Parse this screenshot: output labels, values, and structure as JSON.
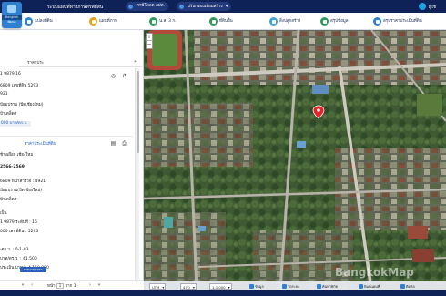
{
  "topbar": {
    "app_title": "ระบบแผนที่ทางภาษีทรัพย์สิน",
    "buttons": [
      {
        "label": "ภาษีโหลด อปท.",
        "icon": "download-icon"
      },
      {
        "label": "ปรับกรอบเลี่ยมสร้าง",
        "icon": "layers-icon"
      }
    ],
    "user_name": "ผู้ใช้"
  },
  "app_badge": {
    "line1": "Bangkok",
    "line2": "พัฒนา"
  },
  "layer_toolbar": {
    "items": [
      {
        "label": "แปลงที่ดิน",
        "icon": "parcel-icon",
        "color": "#2f80d0"
      },
      {
        "label": "แผนที่ภาพ",
        "icon": "map-icon",
        "color": "#e6a21c"
      },
      {
        "label": "น.ส. 3 ก.",
        "icon": "document-icon",
        "color": "#2f9a5a"
      },
      {
        "label": "ที่ดินอื่น",
        "icon": "land-icon",
        "color": "#2f9a5a"
      },
      {
        "label": "สิ่งปลูกสร้าง",
        "icon": "building-icon",
        "color": "#3fa5d8"
      },
      {
        "label": "สรุปข้อมูล",
        "icon": "chart-icon",
        "color": "#2f9a5a"
      },
      {
        "label": "สรุปราคาประเมินที่ดิน",
        "icon": "price-icon",
        "color": "#2f80d0"
      }
    ]
  },
  "panel": {
    "search_label": "ราคาประ",
    "card1": {
      "lines": [
        "1 9879 16",
        "6809 เลขที่ดิน 5293",
        "921",
        "ป้อมปราบ (ปีดเชียงใหม่)",
        "ป้าเตล็ดศ"
      ],
      "price_tag": "000 บาท/ตร.ว."
    },
    "card2": {
      "title": "ราคาประเมินที่ดิน",
      "lines": [
        "ช้างเผือก เชียงใหม่",
        "2566-2569",
        "6809 หน้าสำรวจ : 4921",
        "ป้อมปราบ(ปีดเชียงใหม่)",
        "ป้าเตล็ดศ",
        "เป็น",
        "1 9879 ระดับที่ : 16",
        "000 เลขที่ดิน : 5293",
        "-ตร.ว. : 0-1-03",
        "บาท/ตร.ว. : 41,500",
        "ประเมิน บาท/ : 4,150,000"
      ],
      "report_button": "รายงานราคา"
    },
    "pager": {
      "prefix": "หน้า",
      "page": "1",
      "of": "จาก 1"
    }
  },
  "mapbar": {
    "coord_system": "UTM",
    "zone": "47Q",
    "scale": "1:1,000",
    "items": [
      "ข้อมูล",
      "วัดระยะ",
      "ค้นหาพิกัด",
      "พิมพ์แผนที่",
      "ติดต่อ"
    ]
  },
  "watermark": "BangkokMap",
  "colors": {
    "topbar": "#0e2257",
    "accent": "#2f80d0",
    "pin": "#e8202a"
  }
}
